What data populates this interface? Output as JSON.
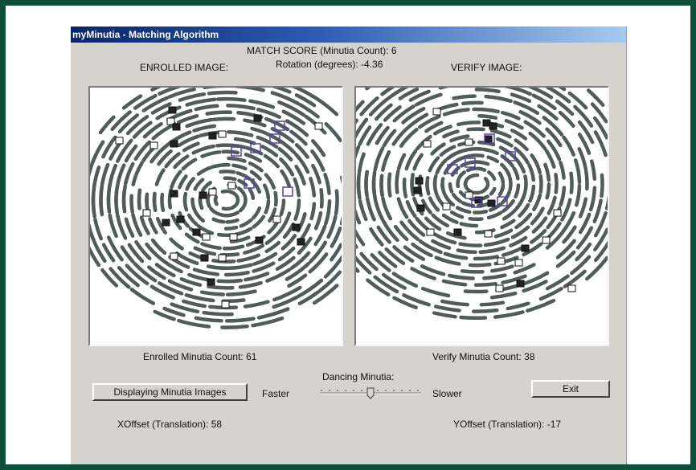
{
  "window": {
    "title": "myMinutia - Matching Algorithm"
  },
  "header": {
    "match_score": "MATCH SCORE (Minutia Count): 6",
    "rotation": "Rotation (degrees):  -4.36",
    "enrolled_label": "ENROLLED IMAGE:",
    "verify_label": "VERIFY IMAGE:"
  },
  "counts": {
    "enrolled": "Enrolled Minutia Count:  61",
    "verify": "Verify Minutia Count:  38"
  },
  "controls": {
    "display_button": "Displaying Minutia Images",
    "dancing_label": "Dancing Minutia:",
    "faster": "Faster",
    "slower": "Slower",
    "exit_button": "Exit"
  },
  "offsets": {
    "x": "XOffset (Translation):  58",
    "y": "YOffset (Translation):  -17"
  },
  "colors": {
    "frame": "#0e4f3c",
    "ridge": "#4f5c5a",
    "match": "#5a3fb0"
  }
}
